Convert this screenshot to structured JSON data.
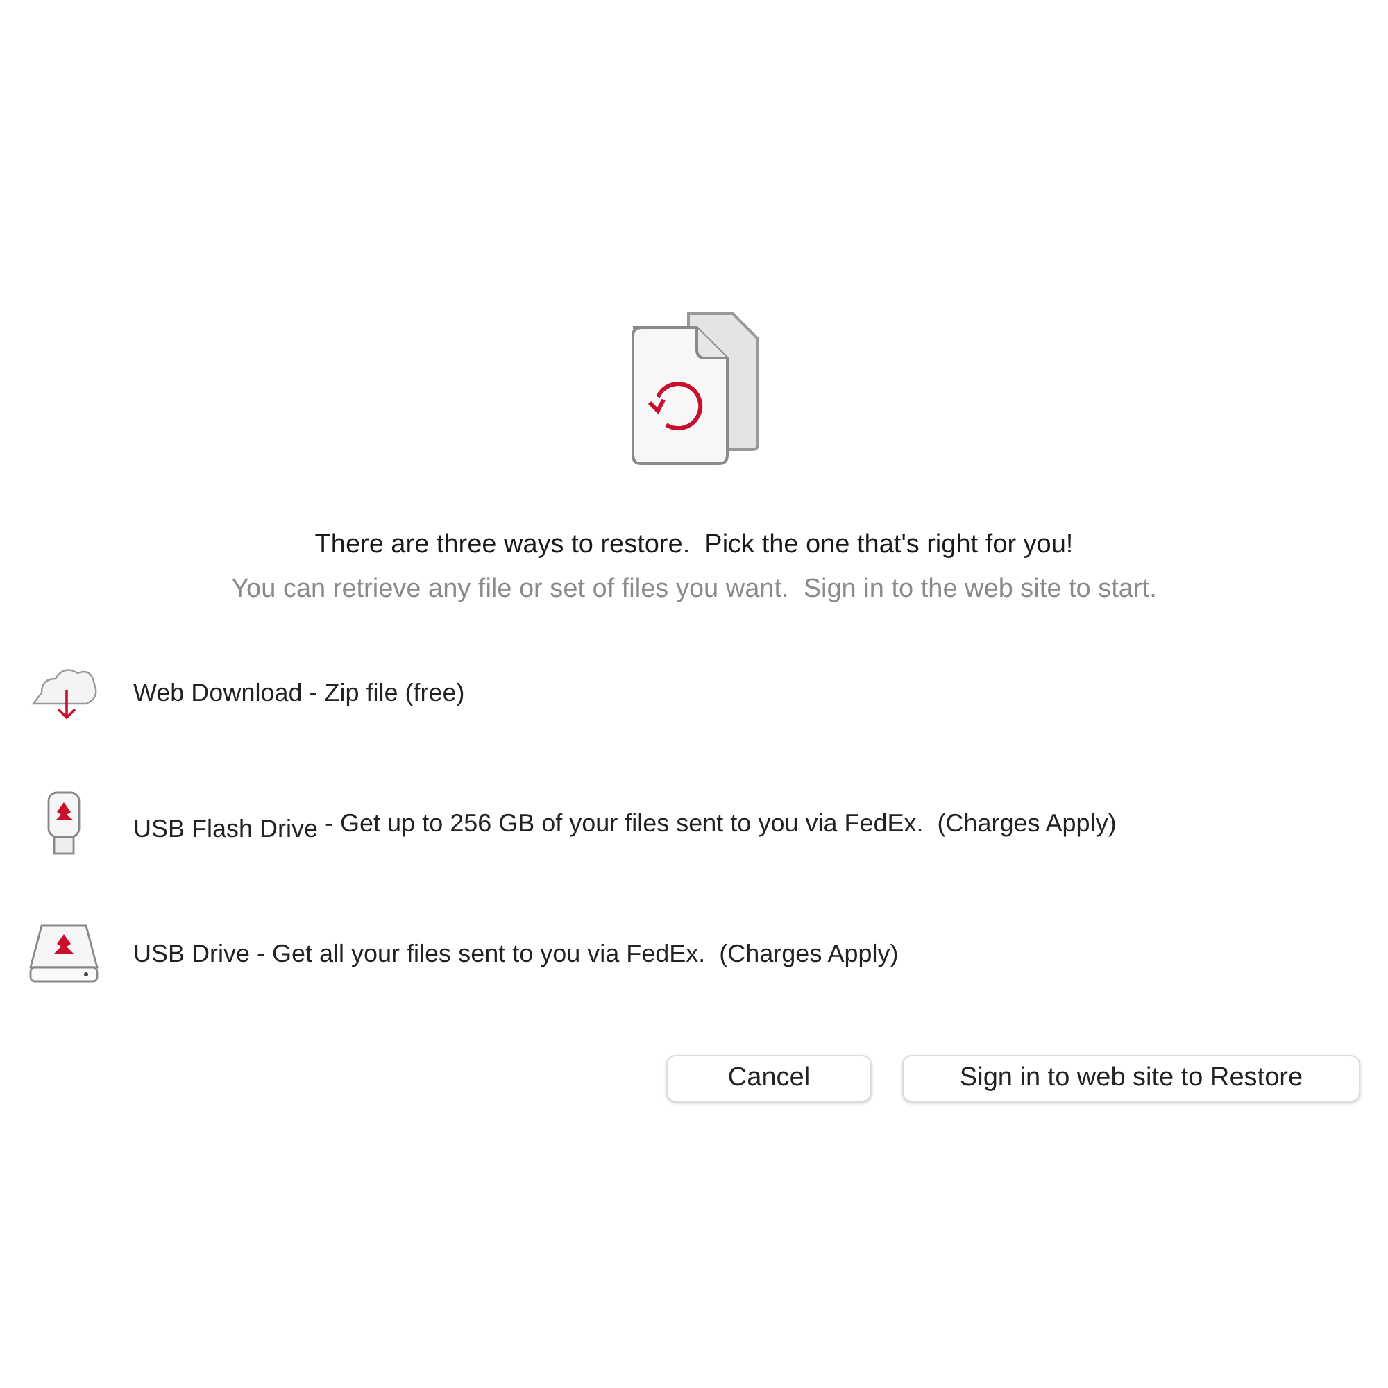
{
  "heading": "There are three ways to restore.  Pick the one that's right for you!",
  "subheading": "You can retrieve any file or set of files you want.  Sign in to the web site to start.",
  "options": [
    {
      "kind": "cloud",
      "name": "Web Download",
      "description": "- Zip file (free)"
    },
    {
      "kind": "flash",
      "name": "USB Flash Drive",
      "description": "- Get up to 256 GB of your files sent to you via FedEx.  (Charges Apply)"
    },
    {
      "kind": "drive",
      "name": "USB Drive",
      "description": "- Get all your files sent to you via FedEx.  (Charges Apply)"
    }
  ],
  "buttons": [
    "Cancel",
    "Sign in to web site to Restore"
  ]
}
